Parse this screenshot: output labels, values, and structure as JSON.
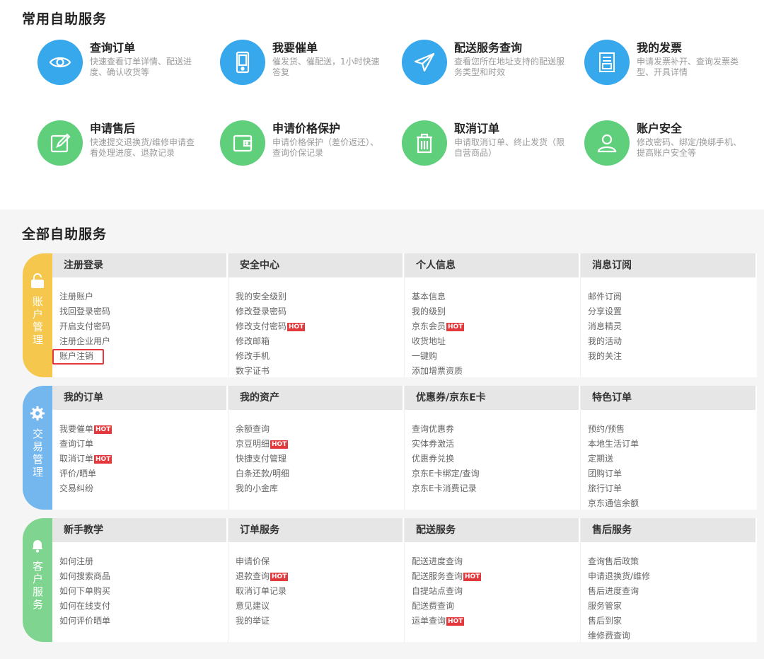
{
  "top": {
    "title": "常用自助服务",
    "cards": [
      {
        "title": "查询订单",
        "desc": "快速查看订单详情、配送进度、确认收货等",
        "icon": "eye-icon",
        "color": "#36a8eb"
      },
      {
        "title": "我要催单",
        "desc": "催发货、催配送，1小时快速答复",
        "icon": "phone-icon",
        "color": "#36a8eb"
      },
      {
        "title": "配送服务查询",
        "desc": "查看您所在地址支持的配送服务类型和时效",
        "icon": "paper-plane-icon",
        "color": "#36a8eb"
      },
      {
        "title": "我的发票",
        "desc": "申请发票补开、查询发票类型、开具详情",
        "icon": "invoice-icon",
        "color": "#36a8eb"
      },
      {
        "title": "申请售后",
        "desc": "快速提交退换货/维修申请查看处理进度、退款记录",
        "icon": "edit-icon",
        "color": "#5fcf7b"
      },
      {
        "title": "申请价格保护",
        "desc": "申请价格保护（差价返还）、查询价保记录",
        "icon": "wallet-icon",
        "color": "#5fcf7b"
      },
      {
        "title": "取消订单",
        "desc": "申请取消订单、终止发货（限自营商品）",
        "icon": "trash-icon",
        "color": "#5fcf7b"
      },
      {
        "title": "账户安全",
        "desc": "修改密码、绑定/换绑手机、提高账户安全等",
        "icon": "user-icon",
        "color": "#5fcf7b"
      }
    ]
  },
  "bottom": {
    "title": "全部自助服务",
    "hot_label": "HOT",
    "groups": [
      {
        "label": "账户管理",
        "icon": "lock-icon",
        "color": "#f5c74d",
        "columns": [
          {
            "title": "注册登录",
            "items": [
              {
                "text": "注册账户"
              },
              {
                "text": "找回登录密码"
              },
              {
                "text": "开启支付密码"
              },
              {
                "text": "注册企业用户"
              },
              {
                "text": "账户注销"
              }
            ]
          },
          {
            "title": "安全中心",
            "items": [
              {
                "text": "我的安全级别"
              },
              {
                "text": "修改登录密码"
              },
              {
                "text": "修改支付密码",
                "hot": true
              },
              {
                "text": "修改邮箱"
              },
              {
                "text": "修改手机"
              },
              {
                "text": "数字证书"
              }
            ]
          },
          {
            "title": "个人信息",
            "items": [
              {
                "text": "基本信息"
              },
              {
                "text": "我的级别"
              },
              {
                "text": "京东会员",
                "hot": true
              },
              {
                "text": "收货地址"
              },
              {
                "text": "一键购"
              },
              {
                "text": "添加增票资质"
              }
            ]
          },
          {
            "title": "消息订阅",
            "items": [
              {
                "text": "邮件订阅"
              },
              {
                "text": "分享设置"
              },
              {
                "text": "消息精灵"
              },
              {
                "text": "我的活动"
              },
              {
                "text": "我的关注"
              }
            ]
          }
        ]
      },
      {
        "label": "交易管理",
        "icon": "gear-icon",
        "color": "#73b7ee",
        "columns": [
          {
            "title": "我的订单",
            "items": [
              {
                "text": "我要催单",
                "hot": true
              },
              {
                "text": "查询订单"
              },
              {
                "text": "取消订单",
                "hot": true
              },
              {
                "text": "评价/晒单"
              },
              {
                "text": "交易纠纷"
              }
            ]
          },
          {
            "title": "我的资产",
            "items": [
              {
                "text": "余额查询"
              },
              {
                "text": "京豆明细",
                "hot": true
              },
              {
                "text": "快捷支付管理"
              },
              {
                "text": "白条还款/明细"
              },
              {
                "text": "我的小金库"
              }
            ]
          },
          {
            "title": "优惠券/京东E卡",
            "items": [
              {
                "text": "查询优惠券"
              },
              {
                "text": "实体券激活"
              },
              {
                "text": "优惠券兑换"
              },
              {
                "text": "京东E卡绑定/查询"
              },
              {
                "text": "京东E卡消费记录"
              }
            ]
          },
          {
            "title": "特色订单",
            "items": [
              {
                "text": "预约/预售"
              },
              {
                "text": "本地生活订单"
              },
              {
                "text": "定期送"
              },
              {
                "text": "团购订单"
              },
              {
                "text": "旅行订单"
              },
              {
                "text": "京东通信余额"
              }
            ]
          }
        ]
      },
      {
        "label": "客户服务",
        "icon": "bell-icon",
        "color": "#7fd48f",
        "columns": [
          {
            "title": "新手教学",
            "items": [
              {
                "text": "如何注册"
              },
              {
                "text": "如何搜索商品"
              },
              {
                "text": "如何下单购买"
              },
              {
                "text": "如何在线支付"
              },
              {
                "text": "如何评价晒单"
              }
            ]
          },
          {
            "title": "订单服务",
            "items": [
              {
                "text": "申请价保"
              },
              {
                "text": "退款查询",
                "hot": true
              },
              {
                "text": "取消订单记录"
              },
              {
                "text": "意见建议"
              },
              {
                "text": "我的举证"
              }
            ]
          },
          {
            "title": "配送服务",
            "items": [
              {
                "text": "配送进度查询"
              },
              {
                "text": "配送服务查询",
                "hot": true
              },
              {
                "text": "自提站点查询"
              },
              {
                "text": "配送费查询"
              },
              {
                "text": "运单查询",
                "hot": true
              }
            ]
          },
          {
            "title": "售后服务",
            "items": [
              {
                "text": "查询售后政策"
              },
              {
                "text": "申请退换货/维修"
              },
              {
                "text": "售后进度查询"
              },
              {
                "text": "服务管家"
              },
              {
                "text": "售后到家"
              },
              {
                "text": "维修费查询"
              }
            ]
          }
        ]
      }
    ]
  }
}
